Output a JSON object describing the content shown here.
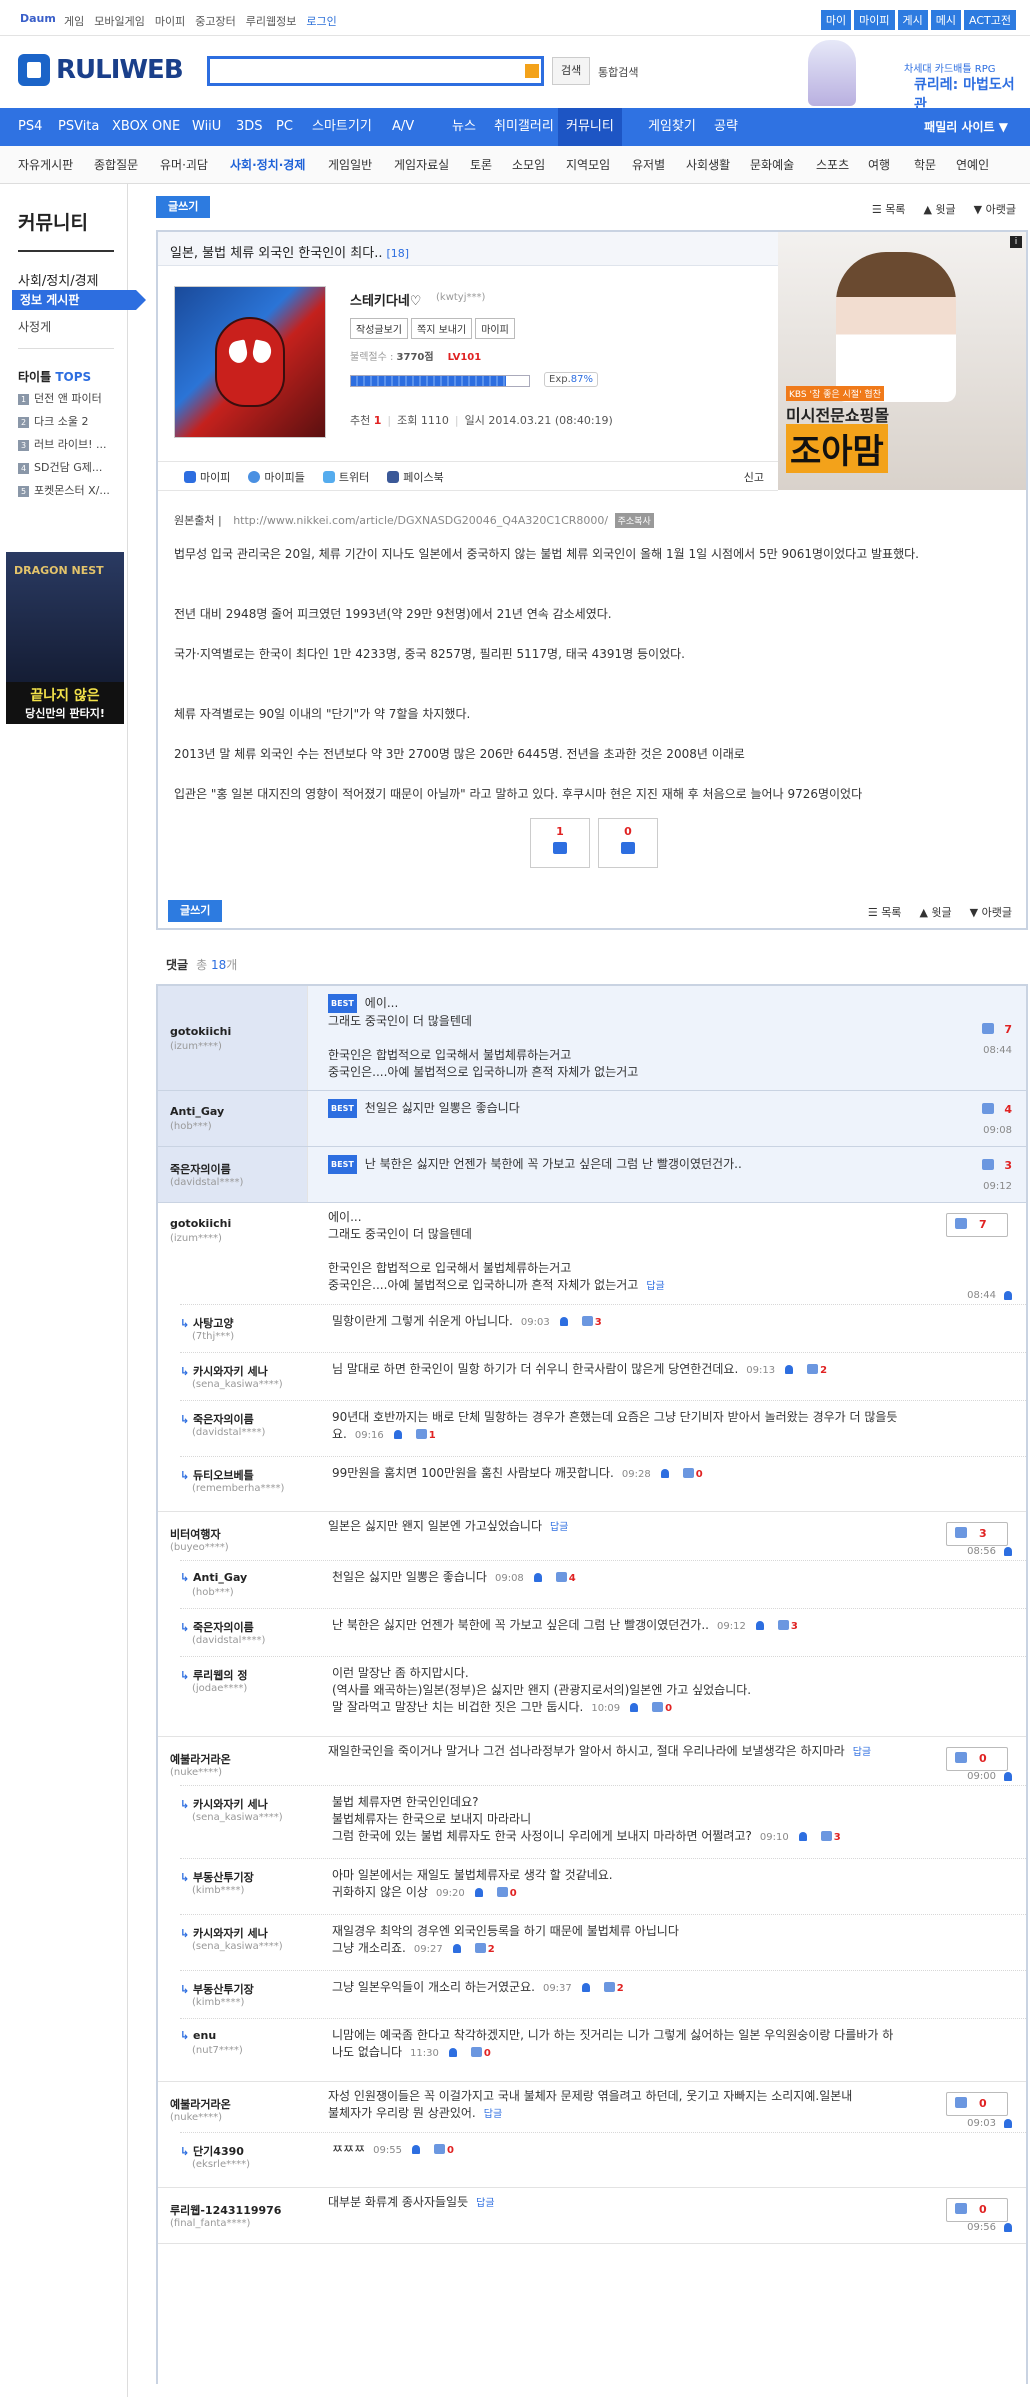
{
  "topbar": {
    "daum": "Daum",
    "links": [
      "게임",
      "모바일게임",
      "마이피",
      "중고장터",
      "루리웹정보",
      "로그인"
    ],
    "right": [
      "마이",
      "마이피",
      "게시",
      "메시",
      "ACT고전"
    ]
  },
  "header": {
    "logo": "RULIWEB",
    "search_btn": "검색",
    "integrated": "통합검색",
    "ad_line1": "차세대 카드배틀 RPG",
    "ad_line2": "큐리레: 마법도서관"
  },
  "nav1": {
    "items": [
      "PS4",
      "PSVita",
      "XBOX ONE",
      "WiiU",
      "3DS",
      "PC",
      "스마트기기",
      "A/V",
      "뉴스",
      "취미갤러리",
      "커뮤니티",
      "게임찾기",
      "공략"
    ],
    "family": "패밀리 사이트 ▼"
  },
  "nav2": {
    "items": [
      "자유게시판",
      "종합질문",
      "유머·괴담",
      "사회·정치·경제",
      "게임일반",
      "게임자료실",
      "토론",
      "소모임",
      "지역모임",
      "유저별",
      "사회생활",
      "문화예술",
      "스포츠",
      "여행",
      "학문",
      "연예인"
    ]
  },
  "sidebar": {
    "title": "커뮤니티",
    "category": "사회/정치/경제",
    "board": "정보 게시판",
    "sub": "사정게",
    "tops_label": "타이틀",
    "tops_em": "TOPS",
    "tops": [
      "던전 앤 파이터",
      "다크 소울 2",
      "러브 라이브! ...",
      "SD건담 G제...",
      "포켓몬스터 X/..."
    ],
    "ad": {
      "title": "DRAGON NEST",
      "line1": "끝나지 않은",
      "line2": "당신만의 판타지!"
    }
  },
  "toolbar": {
    "write": "글쓰기",
    "list": "목록",
    "prev": "윗글",
    "next": "아랫글"
  },
  "post": {
    "title": "일본, 불법 체류 외국인 한국인이 최다..",
    "count": "[18]",
    "author": "스테키다네♡",
    "author_id": "(kwtyj***)",
    "buttons": [
      "작성글보기",
      "쪽지 보내기",
      "마이피"
    ],
    "level_label": "불렉절수 :",
    "level_value": "3770점",
    "level_tag": "LV101",
    "exp_label": "Exp.",
    "exp_percent": "87%",
    "exp": 0.87,
    "meta": {
      "rec_label": "추천",
      "rec": "1",
      "view_label": "조회",
      "views": "1110",
      "date_label": "일시",
      "date": "2014.03.21 (08:40:19)"
    },
    "share": [
      "마이피",
      "마이피들",
      "트위터",
      "페이스북"
    ],
    "report": "신고",
    "source_label": "원본출처",
    "source_url": "http://www.nikkei.com/article/DGXNASDG20046_Q4A320C1CR8000/",
    "source_btn": "주소복사",
    "paragraphs": [
      "법무성 입국 관리국은 20일, 체류 기간이 지나도 일본에서 중국하지 않는 불법 체류 외국인이 올해 1월 1일 시점에서 5만 9061명이었다고 발표했다.",
      "전년 대비 2948명 줄어 피크였던 1993년(약 29만 9천명)에서 21년 연속 감소세였다.",
      "국가·지역별로는 한국이 최다인 1만 4233명, 중국 8257명, 필리핀 5117명, 태국 4391명 등이었다.",
      "체류 자격별로는 90일 이내의 \"단기\"가 약 7할을 차지했다.",
      "2013년 말 체류 외국인 수는 전년보다 약 3만 2700명 많은 206만 6445명. 전년을 초과한 것은 2008년 이래로",
      "입관은 \"홍 일본 대지진의 영향이 적어졌기 때문이 아닐까\" 라고 말하고 있다. 후쿠시마 현은 지진 재해 후 처음으로 늘어나 9726명이었다"
    ],
    "vote_up": "1",
    "vote_down": "0",
    "ad": {
      "tag": "KBS '참 좋은 시절' 협찬",
      "line1": "미시전문쇼핑몰",
      "line2": "조아맘"
    }
  },
  "comments": {
    "label": "댓글",
    "count_prefix": "총",
    "count": "18",
    "count_suffix": "개",
    "best_badge": "BEST",
    "reply_link": "답글",
    "best": [
      {
        "nick": "gotokiichi",
        "id": "(izum****)",
        "lines": [
          "에이...",
          "그래도 중국인이 더 많을텐데",
          "",
          "한국인은 합법적으로 입국해서 불법체류하는거고",
          "중국인은....아예 불법적으로 입국하니까 흔적 자체가 없는거고"
        ],
        "likes": "7",
        "time": "08:44"
      },
      {
        "nick": "Anti_Gay",
        "id": "(hob***)",
        "lines": [
          "천일은 싫지만 일뽕은 좋습니다"
        ],
        "likes": "4",
        "time": "09:08"
      },
      {
        "nick": "죽은자의이름",
        "id": "(davidstal****)",
        "lines": [
          "난 북한은 싫지만 언젠가 북한에 꼭 가보고 싶은데 그럼 난 빨갱이였던건가.."
        ],
        "likes": "3",
        "time": "09:12"
      }
    ],
    "threads": [
      {
        "nick": "gotokiichi",
        "id": "(izum****)",
        "lines": [
          "에이...",
          "그래도 중국인이 더 많을텐데",
          "",
          "한국인은 합법적으로 입국해서 불법체류하는거고",
          "중국인은....아예 불법적으로 입국하니까 흔적 자체가 없는거고"
        ],
        "likes": "7",
        "time": "08:44",
        "replies": [
          {
            "nick": "사탕고양",
            "id": "(7thj***)",
            "lines": [
              "밀항이란게 그렇게 쉬운게 아닙니다."
            ],
            "time": "09:03",
            "likes": "3"
          },
          {
            "nick": "카시와자키 세나",
            "id": "(sena_kasiwa****)",
            "lines": [
              "님 말대로 하면 한국인이 밀항 하기가 더 쉬우니 한국사람이 많은게 당연한건데요."
            ],
            "time": "09:13",
            "likes": "2"
          },
          {
            "nick": "죽은자의이름",
            "id": "(davidstal****)",
            "lines": [
              "90년대 호반까지는 배로 단체 밀항하는 경우가 흔했는데 요즘은 그냥 단기비자 받아서 놀러왔는 경우가 더 많을듯",
              "요."
            ],
            "time": "09:16",
            "likes": "1"
          },
          {
            "nick": "듀티오브베틀",
            "id": "(rememberha****)",
            "lines": [
              "99만원을 훔치면 100만원을 훔친 사람보다 깨끗합니다."
            ],
            "time": "09:28",
            "likes": "0"
          }
        ]
      },
      {
        "nick": "비터여행자",
        "id": "(buyeo****)",
        "lines": [
          "일본은 싫지만 왠지 일본엔 가고싶었습니다"
        ],
        "likes": "3",
        "time": "08:56",
        "replies": [
          {
            "nick": "Anti_Gay",
            "id": "(hob***)",
            "lines": [
              "천일은 싫지만 일뽕은 좋습니다"
            ],
            "time": "09:08",
            "likes": "4"
          },
          {
            "nick": "죽은자의이름",
            "id": "(davidstal****)",
            "lines": [
              "난 북한은 싫지만 언젠가 북한에 꼭 가보고 싶은데 그럼 난 빨갱이였던건가.."
            ],
            "time": "09:12",
            "likes": "3"
          },
          {
            "nick": "루리웹의 정",
            "id": "(jodae****)",
            "lines": [
              "이런 말장난 좀 하지맙시다.",
              "(역사를 왜곡하는)일본(정부)은 싫지만 왠지 (관광지로서의)일본엔 가고 싶었습니다.",
              "말 잘라먹고 말장난 치는 비겁한 짓은 그만 둡시다."
            ],
            "time": "10:09",
            "likes": "0"
          }
        ]
      },
      {
        "nick": "예불라거라온",
        "id": "(nuke****)",
        "lines": [
          "재일한국인을 죽이거나 말거나 그건 섬나라정부가 알아서 하시고, 절대 우리나라에 보낼생각은 하지마라"
        ],
        "likes": "0",
        "time": "09:00",
        "replies": [
          {
            "nick": "카시와자키 세나",
            "id": "(sena_kasiwa****)",
            "lines": [
              "불법 체류자면 한국인인데요?",
              "불법체류자는 한국으로 보내지 마라라니",
              "그럼 한국에 있는 불법 체류자도 한국 사정이니 우리에게 보내지 마라하면 어쩔려고?"
            ],
            "time": "09:10",
            "likes": "3"
          },
          {
            "nick": "부동산투기장",
            "id": "(kimb****)",
            "lines": [
              "아마 일본에서는 재일도 불법체류자로 생각 할 것같네요.",
              "귀화하지 않은 이상"
            ],
            "time": "09:20",
            "likes": "0"
          },
          {
            "nick": "카시와자키 세나",
            "id": "(sena_kasiwa****)",
            "lines": [
              "재일경우 최악의 경우엔 외국인등록을 하기 때문에 불법체류 아닙니다",
              "그냥 개소리죠."
            ],
            "time": "09:27",
            "likes": "2"
          },
          {
            "nick": "부동산투기장",
            "id": "(kimb****)",
            "lines": [
              "그냥 일본우익들이 개소리 하는거였군요."
            ],
            "time": "09:37",
            "likes": "2"
          },
          {
            "nick": "enu",
            "id": "(nut7****)",
            "lines": [
              "니맘에는 예국좀 한다고 착각하겠지만, 니가 하는 짓거리는 니가 그렇게 싫어하는 일본 우익원숭이랑 다를바가 하",
              "나도 없습니다"
            ],
            "time": "11:30",
            "likes": "0"
          }
        ]
      },
      {
        "nick": "예불라거라온",
        "id": "(nuke****)",
        "lines": [
          "자성 인원쟁이들은 꼭 이걸가지고 국내 불체자 문제랑 엮을려고 하던데, 웃기고 자빠지는 소리지예.일본내",
          "불체자가 우리랑 뭔 상관있어."
        ],
        "likes": "0",
        "time": "09:03",
        "replies": [
          {
            "nick": "단기4390",
            "id": "(eksrle****)",
            "lines": [
              "ㅉㅉㅉ"
            ],
            "time": "09:55",
            "likes": "0"
          }
        ]
      },
      {
        "nick": "루리웹-1243119976",
        "id": "(final_fanta****)",
        "lines": [
          "대부분 화류계 종사자들일듯"
        ],
        "likes": "0",
        "time": "09:56",
        "replies": []
      }
    ]
  }
}
